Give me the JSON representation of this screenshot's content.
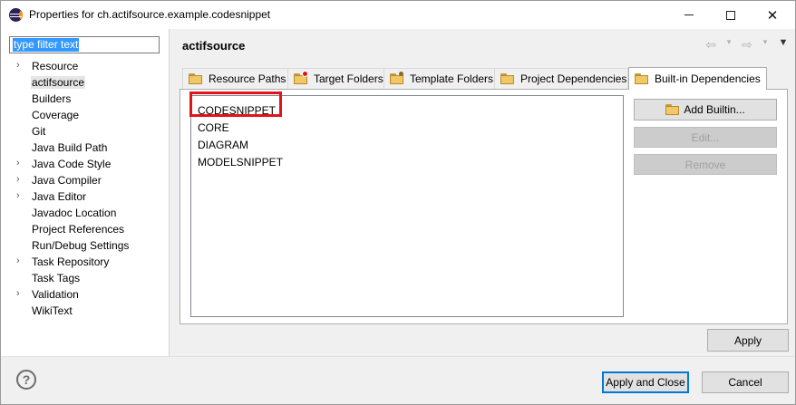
{
  "window": {
    "title": "Properties for ch.actifsource.example.codesnippet",
    "icon": "eclipse-icon"
  },
  "filter": {
    "value": "type filter text"
  },
  "tree": [
    {
      "label": "Resource",
      "expandable": true
    },
    {
      "label": "actifsource",
      "expandable": false,
      "selected": true
    },
    {
      "label": "Builders",
      "expandable": false
    },
    {
      "label": "Coverage",
      "expandable": false
    },
    {
      "label": "Git",
      "expandable": false
    },
    {
      "label": "Java Build Path",
      "expandable": false
    },
    {
      "label": "Java Code Style",
      "expandable": true
    },
    {
      "label": "Java Compiler",
      "expandable": true
    },
    {
      "label": "Java Editor",
      "expandable": true
    },
    {
      "label": "Javadoc Location",
      "expandable": false
    },
    {
      "label": "Project References",
      "expandable": false
    },
    {
      "label": "Run/Debug Settings",
      "expandable": false
    },
    {
      "label": "Task Repository",
      "expandable": true
    },
    {
      "label": "Task Tags",
      "expandable": false
    },
    {
      "label": "Validation",
      "expandable": true
    },
    {
      "label": "WikiText",
      "expandable": false
    }
  ],
  "page": {
    "title": "actifsource"
  },
  "tabs": [
    {
      "label": "Resource Paths",
      "icon": "folder-icon"
    },
    {
      "label": "Target Folders",
      "icon": "target-folder-icon"
    },
    {
      "label": "Template Folders",
      "icon": "template-folder-icon"
    },
    {
      "label": "Project Dependencies",
      "icon": "folder-icon"
    },
    {
      "label": "Built-in Dependencies",
      "icon": "folder-icon",
      "active": true
    }
  ],
  "builtins": [
    "CODESNIPPET",
    "CORE",
    "DIAGRAM",
    "MODELSNIPPET"
  ],
  "buttons": {
    "add": "Add Builtin...",
    "edit": "Edit...",
    "remove": "Remove",
    "apply": "Apply",
    "apply_close": "Apply and Close",
    "cancel": "Cancel"
  },
  "colors": {
    "highlight": "#e0151b",
    "selection": "#3399ff",
    "default_button_border": "#0078d7"
  }
}
